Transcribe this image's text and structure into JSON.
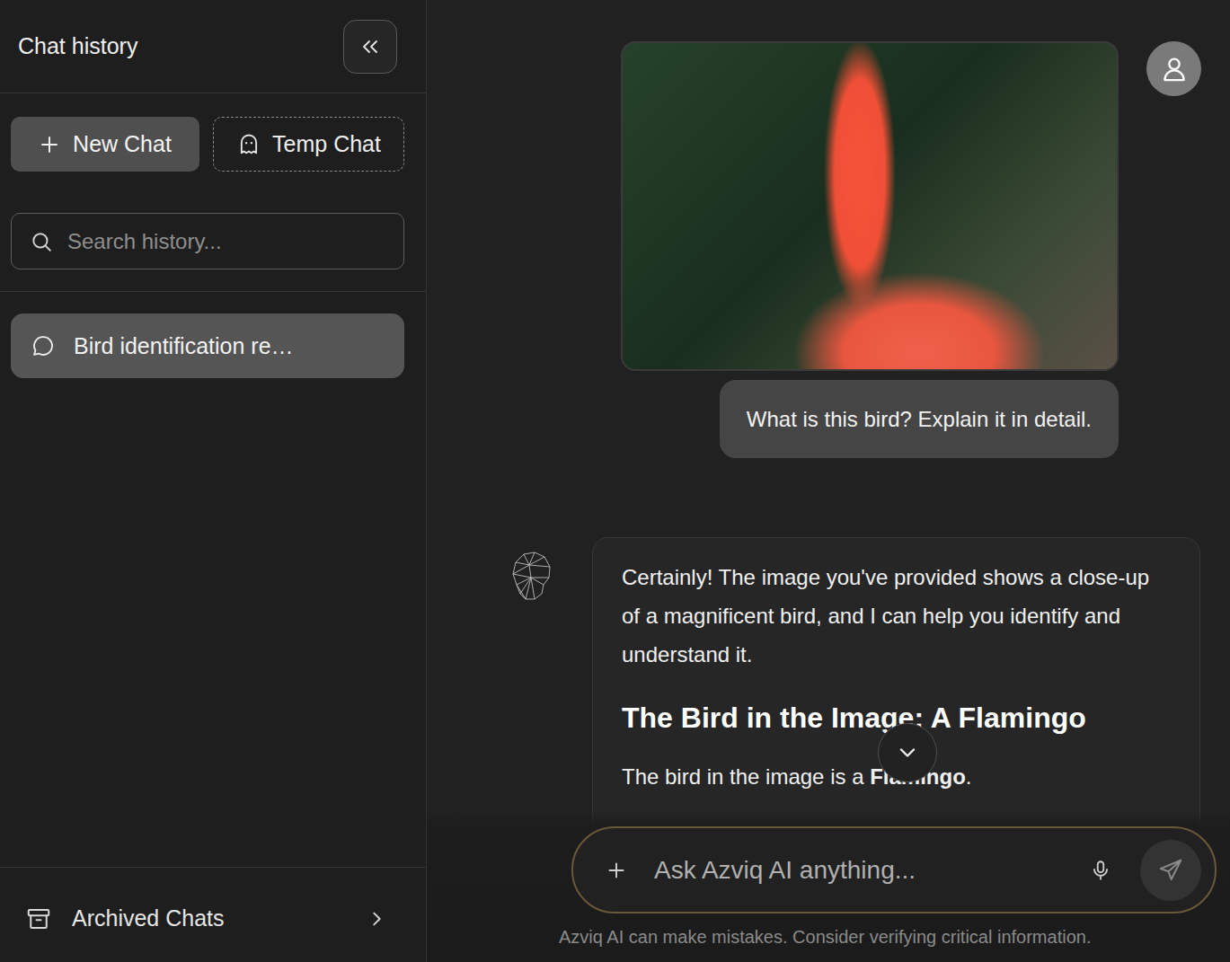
{
  "sidebar": {
    "title": "Chat history",
    "new_chat": "New Chat",
    "temp_chat": "Temp Chat",
    "search": {
      "placeholder": "Search history..."
    },
    "items": [
      {
        "label": "Bird identification re…",
        "selected": true
      }
    ],
    "archived": "Archived Chats"
  },
  "conversation": {
    "user": {
      "text": "What is this bird? Explain it in detail."
    },
    "assistant": [
      {
        "kind": "paragraph",
        "runs": [
          {
            "text": "Certainly! The image you've provided shows a close-up of a magnificent bird, and I can help you identify and understand it.",
            "bold": false
          }
        ]
      },
      {
        "kind": "heading",
        "runs": [
          {
            "text": "The Bird in the Image: A Flamingo",
            "bold": true
          }
        ]
      },
      {
        "kind": "paragraph",
        "runs": [
          {
            "text": "The bird in the image is a ",
            "bold": false
          },
          {
            "text": "Flamingo",
            "bold": true
          },
          {
            "text": ".",
            "bold": false
          }
        ]
      }
    ]
  },
  "composer": {
    "placeholder": "Ask Azviq AI anything..."
  },
  "disclaimer": "Azviq AI can make mistakes. Consider verifying critical information."
}
